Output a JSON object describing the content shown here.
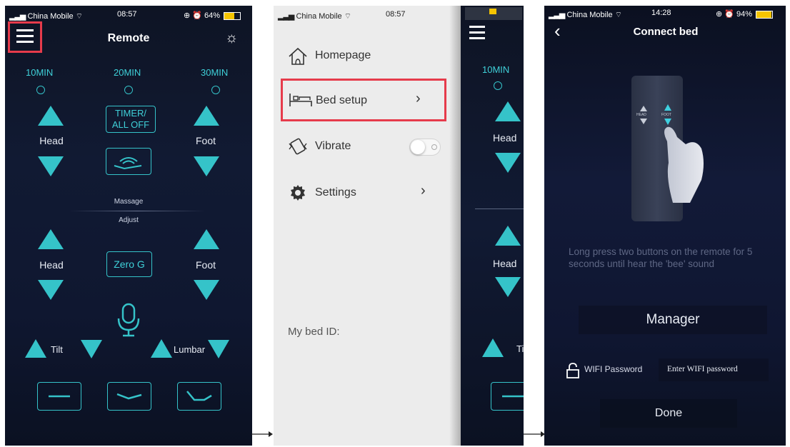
{
  "colors": {
    "accent": "#35c3c9",
    "highlight_red": "#e63b4b",
    "panel_dark": "#111a33",
    "menu_bg": "#ececec"
  },
  "panel1": {
    "status": {
      "carrier": "China Mobile",
      "time": "08:57",
      "battery": "64%"
    },
    "title": "Remote",
    "timers": [
      "10MIN",
      "20MIN",
      "30MIN"
    ],
    "timer_all_off": [
      "TIMER/",
      "ALL OFF"
    ],
    "head_label": "Head",
    "foot_label": "Foot",
    "massage_label": "Massage",
    "adjust_label": "Adjust",
    "head_label2": "Head",
    "foot_label2": "Foot",
    "zero_g": "Zero G",
    "tilt_label": "Tilt",
    "lumbar_label": "Lumbar"
  },
  "panel2": {
    "status": {
      "carrier": "China Mobile",
      "time": "08:57"
    },
    "menu": [
      {
        "label": "Homepage",
        "icon": "home-icon"
      },
      {
        "label": "Bed setup",
        "icon": "bed-icon"
      },
      {
        "label": "Vibrate",
        "icon": "vibrate-icon"
      },
      {
        "label": "Settings",
        "icon": "gear-icon"
      }
    ],
    "vibrate_on": false,
    "bed_id_label": "My bed ID:",
    "behind": {
      "timer": "10MIN",
      "head": "Head",
      "head2": "Head",
      "tilt": "Ti"
    }
  },
  "panel3": {
    "status": {
      "carrier": "China Mobile",
      "time": "14:28",
      "battery": "94%"
    },
    "title": "Connect bed",
    "remote_head": "HEAD",
    "remote_foot": "FOOT",
    "instructions": "Long press two buttons on the remote for 5 seconds until hear the 'bee' sound",
    "manager": "Manager",
    "wifi_label": "WIFI Password",
    "wifi_placeholder": "Enter WIFI password",
    "done": "Done"
  }
}
